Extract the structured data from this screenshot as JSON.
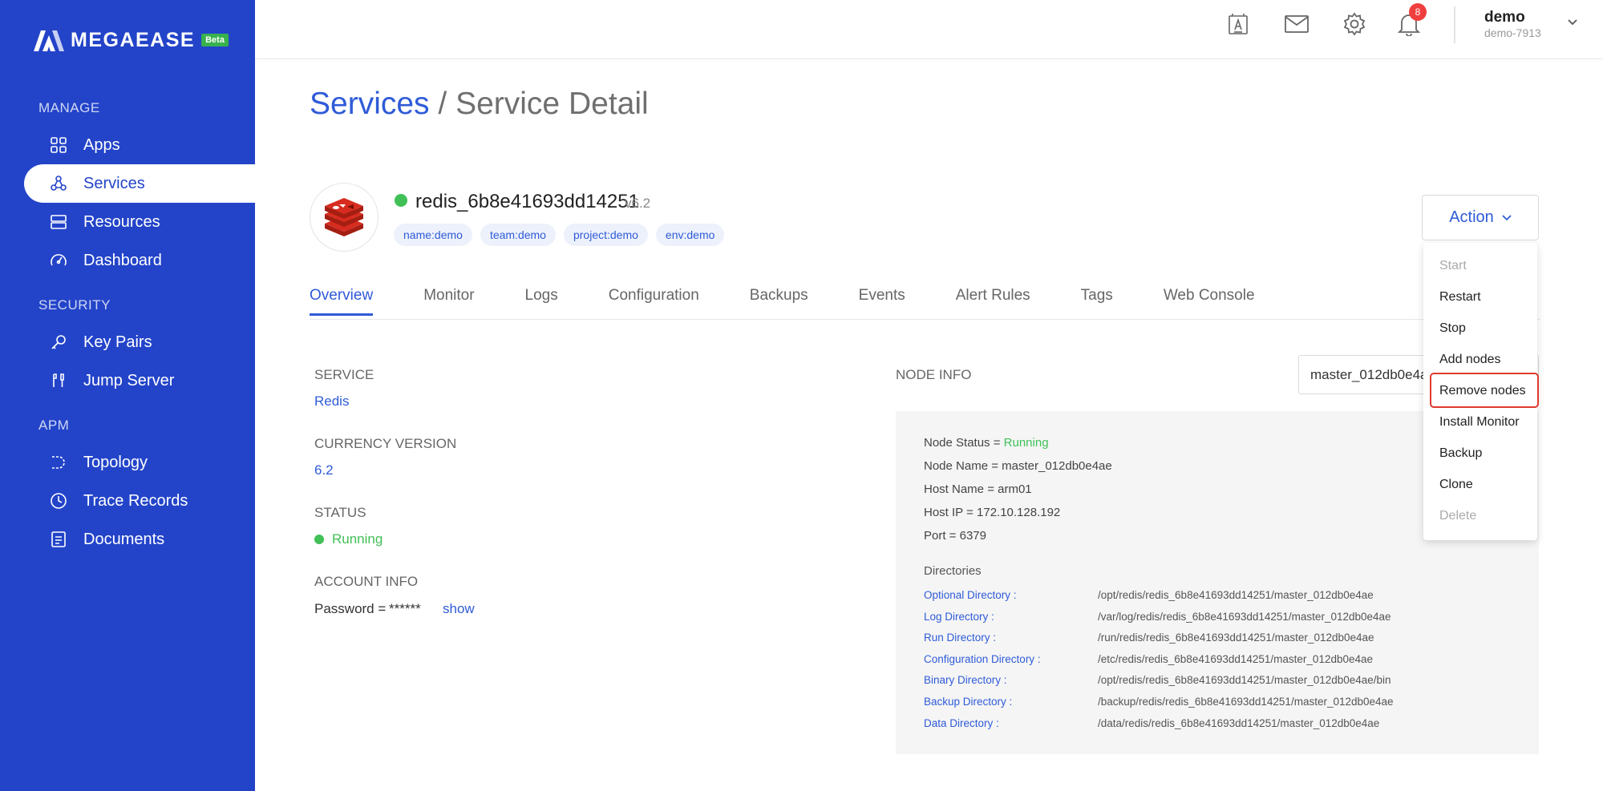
{
  "brand": {
    "name": "MEGAEASE",
    "badge": "Beta"
  },
  "sidebar": {
    "sections": [
      {
        "label": "MANAGE"
      },
      {
        "label": "SECURITY"
      },
      {
        "label": "APM"
      }
    ],
    "items": [
      {
        "label": "Apps",
        "icon": "grid-icon"
      },
      {
        "label": "Services",
        "icon": "services-icon",
        "active": true
      },
      {
        "label": "Resources",
        "icon": "server-icon"
      },
      {
        "label": "Dashboard",
        "icon": "gauge-icon"
      },
      {
        "label": "Key Pairs",
        "icon": "key-icon"
      },
      {
        "label": "Jump Server",
        "icon": "jump-icon"
      },
      {
        "label": "Topology",
        "icon": "topology-icon"
      },
      {
        "label": "Trace Records",
        "icon": "clock-icon"
      },
      {
        "label": "Documents",
        "icon": "document-icon"
      }
    ]
  },
  "topbar": {
    "notification_count": "8",
    "user": {
      "name": "demo",
      "account": "demo-7913"
    }
  },
  "breadcrumb": {
    "root": "Services",
    "separator": "/",
    "current": "Service Detail"
  },
  "service": {
    "name": "redis_6b8e41693dd14251",
    "version": "v6.2",
    "status_color": "#40c057",
    "tags": [
      "name:demo",
      "team:demo",
      "project:demo",
      "env:demo"
    ]
  },
  "action": {
    "label": "Action",
    "menu": [
      {
        "label": "Start",
        "disabled": true
      },
      {
        "label": "Restart",
        "disabled": false
      },
      {
        "label": "Stop",
        "disabled": false
      },
      {
        "label": "Add nodes",
        "disabled": false
      },
      {
        "label": "Remove nodes",
        "disabled": false,
        "highlighted": true
      },
      {
        "label": "Install Monitor",
        "disabled": false
      },
      {
        "label": "Backup",
        "disabled": false
      },
      {
        "label": "Clone",
        "disabled": false
      },
      {
        "label": "Delete",
        "disabled": true
      }
    ]
  },
  "tabs": [
    {
      "label": "Overview",
      "active": true
    },
    {
      "label": "Monitor"
    },
    {
      "label": "Logs"
    },
    {
      "label": "Configuration"
    },
    {
      "label": "Backups"
    },
    {
      "label": "Events"
    },
    {
      "label": "Alert Rules"
    },
    {
      "label": "Tags"
    },
    {
      "label": "Web Console"
    }
  ],
  "overview": {
    "service_label": "SERVICE",
    "service_value": "Redis",
    "version_label": "CURRENCY VERSION",
    "version_value": "6.2",
    "status_label": "STATUS",
    "status_value": "Running",
    "account_label": "ACCOUNT INFO",
    "password_label": "Password =",
    "password_mask": "******",
    "show_label": "show"
  },
  "node_info": {
    "label": "NODE INFO",
    "selected_node": "master_012db0e4ae",
    "status_key": "Node Status = ",
    "status_value": "Running",
    "name_line": "Node Name = master_012db0e4ae",
    "host_line": "Host Name = arm01",
    "ip_line": "Host IP = 172.10.128.192",
    "port_line": "Port = 6379",
    "directories_title": "Directories",
    "directories": [
      {
        "name": "Optional Directory :",
        "path": "/opt/redis/redis_6b8e41693dd14251/master_012db0e4ae"
      },
      {
        "name": "Log Directory :",
        "path": "/var/log/redis/redis_6b8e41693dd14251/master_012db0e4ae"
      },
      {
        "name": "Run Directory :",
        "path": "/run/redis/redis_6b8e41693dd14251/master_012db0e4ae"
      },
      {
        "name": "Configuration Directory :",
        "path": "/etc/redis/redis_6b8e41693dd14251/master_012db0e4ae"
      },
      {
        "name": "Binary Directory :",
        "path": "/opt/redis/redis_6b8e41693dd14251/master_012db0e4ae/bin"
      },
      {
        "name": "Backup Directory :",
        "path": "/backup/redis/redis_6b8e41693dd14251/master_012db0e4ae"
      },
      {
        "name": "Data Directory :",
        "path": "/data/redis/redis_6b8e41693dd14251/master_012db0e4ae"
      }
    ]
  },
  "colors": {
    "sidebar": "#2344c9",
    "accent": "#2f5bd8",
    "success": "#40c057",
    "danger": "#e03a2f"
  }
}
